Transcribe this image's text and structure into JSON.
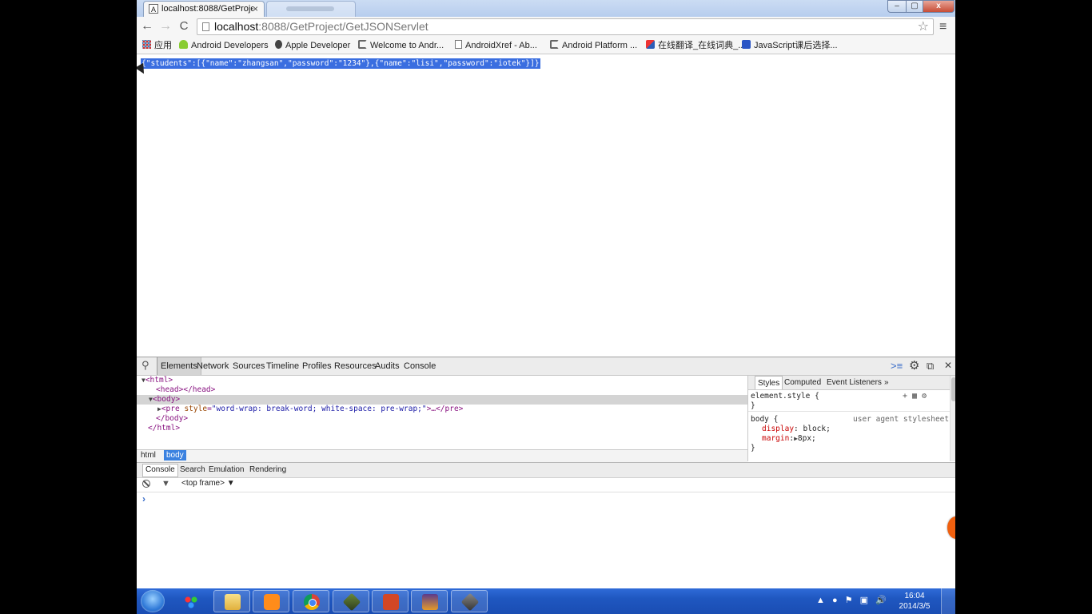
{
  "browser": {
    "active_tab_title": "localhost:8088/GetProje",
    "active_tab_favicon": "page-favicon",
    "close_tab_glyph": "×",
    "window_controls": {
      "minimize": "–",
      "maximize": "▢",
      "close": "x"
    }
  },
  "toolbar": {
    "back_glyph": "←",
    "forward_glyph": "→",
    "reload_glyph": "C",
    "url_host": "localhost",
    "url_path": ":8088/GetProject/GetJSONServlet",
    "star_glyph": "☆",
    "menu_glyph": "≡"
  },
  "bookmarks": [
    {
      "label": "应用",
      "icon": "apps-icon"
    },
    {
      "label": "Android Developers",
      "icon": "android-icon"
    },
    {
      "label": "Apple Developer",
      "icon": "apple-icon"
    },
    {
      "label": "Welcome to Andr...",
      "icon": "page-icon"
    },
    {
      "label": "AndroidXref - Ab...",
      "icon": "page-icon"
    },
    {
      "label": "Android Platform ...",
      "icon": "page-icon"
    },
    {
      "label": "在线翻译_在线词典_...",
      "icon": "fanyi-icon"
    },
    {
      "label": "JavaScript课后选择...",
      "icon": "baidu-icon"
    }
  ],
  "page": {
    "json_text": "{\"students\":[{\"name\":\"zhangsan\",\"password\":\"1234\"},{\"name\":\"lisi\",\"password\":\"iotek\"}]}"
  },
  "devtools": {
    "tabs": [
      "Elements",
      "Network",
      "Sources",
      "Timeline",
      "Profiles",
      "Resources",
      "Audits",
      "Console"
    ],
    "active_tab": "Elements",
    "dom": {
      "html_open": "<html>",
      "head": "<head></head>",
      "body_open": "<body>",
      "pre_tag": "<pre",
      "pre_attr_name": "style",
      "pre_attr_value": "\"word-wrap: break-word; white-space: pre-wrap;\"",
      "pre_close": ">…</pre>",
      "body_close": "</body>",
      "html_close": "</html>"
    },
    "breadcrumbs": [
      "html",
      "body"
    ],
    "styles": {
      "tabs": [
        "Styles",
        "Computed",
        "Event Listeners",
        "»"
      ],
      "element_style": "element.style {",
      "close_brace": "}",
      "body_selector": "body {",
      "ua_label": "user agent stylesheet",
      "prop1_name": "display",
      "prop1_value": "block;",
      "prop2_name": "margin",
      "prop2_value": "8px;"
    },
    "drawer_tabs": [
      "Console",
      "Search",
      "Emulation",
      "Rendering"
    ],
    "frame_selector": "<top frame>",
    "prompt": "›"
  },
  "taskbar": {
    "apps": [
      "ime",
      "explorer",
      "media-player",
      "chrome",
      "android-sdk",
      "powerpoint",
      "eclipse-ee",
      "tool"
    ],
    "clock_time": "16:04",
    "clock_date": "2014/3/5"
  }
}
